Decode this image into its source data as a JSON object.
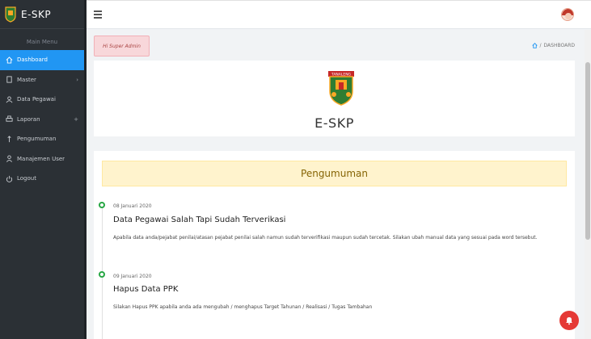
{
  "app": {
    "title": "E-SKP"
  },
  "sidebar": {
    "heading": "Main Menu",
    "items": [
      {
        "label": "Dashboard",
        "icon": "home-icon",
        "active": true,
        "caret": ""
      },
      {
        "label": "Master",
        "icon": "book-icon",
        "active": false,
        "caret": "›"
      },
      {
        "label": "Data Pegawai",
        "icon": "users-icon",
        "active": false,
        "caret": ""
      },
      {
        "label": "Laporan",
        "icon": "printer-icon",
        "active": false,
        "caret": "+"
      },
      {
        "label": "Pengumuman",
        "icon": "megaphone-icon",
        "active": false,
        "caret": ""
      },
      {
        "label": "Manajemen User",
        "icon": "user-icon",
        "active": false,
        "caret": ""
      },
      {
        "label": "Logout",
        "icon": "power-icon",
        "active": false,
        "caret": ""
      }
    ]
  },
  "header": {
    "greeting": "Hi Super Admin",
    "breadcrumb": "DASHBOARD"
  },
  "logo_card": {
    "title": "E-SKP",
    "emblem_text": "TANALENG"
  },
  "announcements": {
    "title": "Pengumuman",
    "items": [
      {
        "date": "08 Januari 2020",
        "title": "Data Pegawai Salah Tapi Sudah Terverikasi",
        "body": "Apabila data anda/pejabat penilai/atasan pejabat penilai salah namun sudah terverifikasi maupun sudah tercetak. Silakan ubah manual data yang sesuai pada word tersebut."
      },
      {
        "date": "09 Januari 2020",
        "title": "Hapus Data PPK",
        "body": "Silakan Hapus PPK apabila anda ada mengubah / menghapus Target Tahunan / Realisasi / Tugas Tambahan"
      }
    ]
  },
  "colors": {
    "sidebar_bg": "#2b3035",
    "active": "#2196f3",
    "greeting_bg": "#f8d7da",
    "news_header_bg": "#fff3cd",
    "timeline_dot": "#28a745",
    "notification": "#e53935"
  }
}
